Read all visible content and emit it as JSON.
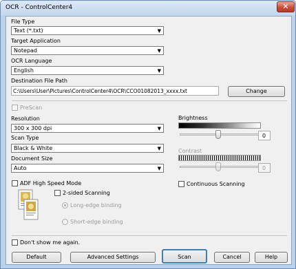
{
  "window": {
    "title": "OCR - ControlCenter4",
    "close_glyph": "✕"
  },
  "file_type": {
    "label": "File Type",
    "value": "Text (*.txt)"
  },
  "target_app": {
    "label": "Target Application",
    "value": "Notepad"
  },
  "ocr_language": {
    "label": "OCR Language",
    "value": "English"
  },
  "destination": {
    "label": "Destination File Path",
    "value": "C:\\Users\\User\\Pictures\\ControlCenter4\\OCR\\CCO01082013_xxxx.txt",
    "change_label": "Change"
  },
  "prescan": {
    "label": "PreScan",
    "checked": false,
    "enabled": false
  },
  "resolution": {
    "label": "Resolution",
    "value": "300 x 300 dpi"
  },
  "scan_type": {
    "label": "Scan Type",
    "value": "Black & White"
  },
  "document_size": {
    "label": "Document Size",
    "value": "Auto"
  },
  "brightness": {
    "label": "Brightness",
    "value": "0",
    "enabled": true
  },
  "contrast": {
    "label": "Contrast",
    "value": "0",
    "enabled": false
  },
  "adf_high_speed": {
    "label": "ADF High Speed Mode",
    "checked": false
  },
  "continuous": {
    "label": "Continuous Scanning",
    "checked": false
  },
  "two_sided": {
    "label": "2-sided Scanning",
    "checked": false,
    "options": [
      {
        "label": "Long-edge binding",
        "selected": true,
        "enabled": false
      },
      {
        "label": "Short-edge binding",
        "selected": false,
        "enabled": false
      }
    ]
  },
  "dont_show": {
    "label": "Don't show me again.",
    "checked": false
  },
  "buttons": {
    "default": "Default",
    "advanced": "Advanced Settings",
    "scan": "Scan",
    "cancel": "Cancel",
    "help": "Help"
  },
  "icons": {
    "dropdown_arrow": "▼"
  },
  "colors": {
    "title_bar": "#c2d7ee",
    "close_button": "#c6503c",
    "dialog_bg": "#f0f0f0",
    "scan_button_border": "#3c7fb1"
  }
}
